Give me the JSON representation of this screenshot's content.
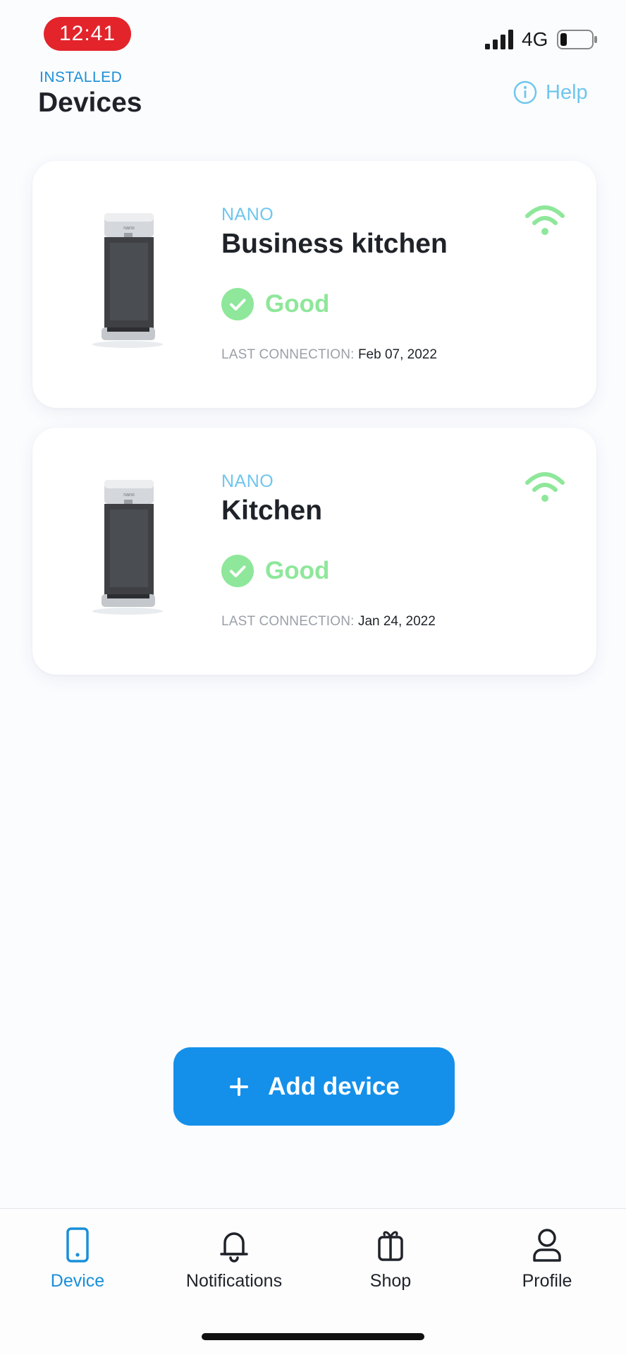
{
  "status_bar": {
    "time": "12:41",
    "network": "4G"
  },
  "header": {
    "section_label": "INSTALLED",
    "title": "Devices",
    "help_label": "Help"
  },
  "devices": [
    {
      "brand": "NANO",
      "name": "Business kitchen",
      "status": "Good",
      "last_connection_label": "LAST CONNECTION:",
      "last_connection_date": "Feb 07, 2022"
    },
    {
      "brand": "NANO",
      "name": "Kitchen",
      "status": "Good",
      "last_connection_label": "LAST CONNECTION:",
      "last_connection_date": "Jan 24, 2022"
    }
  ],
  "add_button": {
    "label": "Add device"
  },
  "tabs": [
    {
      "label": "Device",
      "icon": "phone-icon",
      "active": true
    },
    {
      "label": "Notifications",
      "icon": "bell-icon",
      "active": false
    },
    {
      "label": "Shop",
      "icon": "gift-icon",
      "active": false
    },
    {
      "label": "Profile",
      "icon": "user-icon",
      "active": false
    }
  ],
  "colors": {
    "accent": "#1590ea",
    "good": "#8ee79a",
    "brand_light": "#6fc6ee",
    "alert": "#e3242b"
  }
}
